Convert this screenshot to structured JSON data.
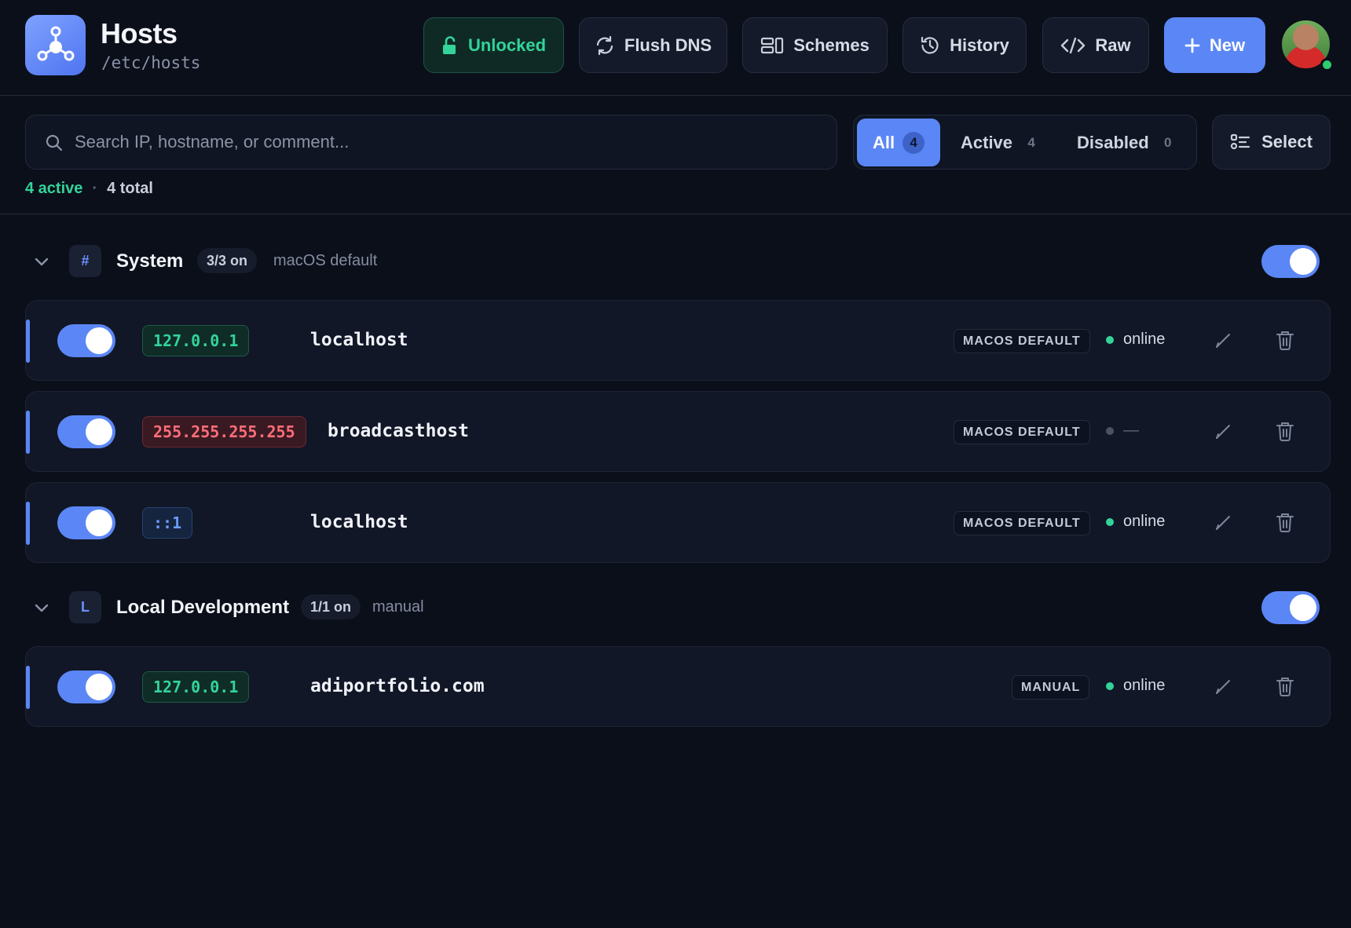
{
  "app": {
    "title": "Hosts",
    "path": "/etc/hosts",
    "logo_icon": "network-hub-icon"
  },
  "header_buttons": {
    "unlocked": "Unlocked",
    "flush_dns": "Flush DNS",
    "schemes": "Schemes",
    "history": "History",
    "raw": "Raw",
    "new": "New"
  },
  "search": {
    "placeholder": "Search IP, hostname, or comment...",
    "value": ""
  },
  "filters": [
    {
      "label": "All",
      "count": "4",
      "selected": true
    },
    {
      "label": "Active",
      "count": "4",
      "selected": false
    },
    {
      "label": "Disabled",
      "count": "0",
      "selected": false
    }
  ],
  "select_label": "Select",
  "summary": {
    "active": "4 active",
    "separator": "·",
    "total": "4 total"
  },
  "groups": [
    {
      "letter": "#",
      "name": "System",
      "pill": "3/3 on",
      "subtitle": "macOS default",
      "enabled": true,
      "hosts": [
        {
          "ip": "127.0.0.1",
          "ip_color": "green",
          "hostname": "localhost",
          "source": "MACOS DEFAULT",
          "status": "online",
          "status_on": true,
          "enabled": true
        },
        {
          "ip": "255.255.255.255",
          "ip_color": "red",
          "hostname": "broadcasthost",
          "source": "MACOS DEFAULT",
          "status": "—",
          "status_on": false,
          "enabled": true
        },
        {
          "ip": "::1",
          "ip_color": "blue",
          "hostname": "localhost",
          "source": "MACOS DEFAULT",
          "status": "online",
          "status_on": true,
          "enabled": true
        }
      ]
    },
    {
      "letter": "L",
      "name": "Local Development",
      "pill": "1/1 on",
      "subtitle": "manual",
      "enabled": true,
      "hosts": [
        {
          "ip": "127.0.0.1",
          "ip_color": "green",
          "hostname": "adiportfolio.com",
          "source": "MANUAL",
          "status": "online",
          "status_on": true,
          "enabled": true
        }
      ]
    }
  ],
  "colors": {
    "background": "#0b0f1a",
    "accent": "#5b86f5",
    "success": "#34d39a",
    "danger": "#ff6e7a"
  }
}
